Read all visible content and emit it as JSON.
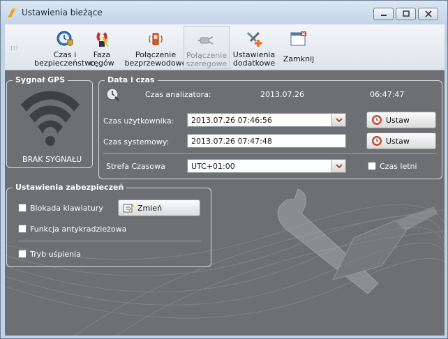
{
  "window": {
    "title": "Ustawienia bieżące"
  },
  "toolbar": {
    "buttons": [
      {
        "label": "Czas i\nbezpieczeństwo",
        "icon": "clock-shield-icon",
        "enabled": true
      },
      {
        "label": "Faza\ncęgów",
        "icon": "clamp-phase-icon",
        "enabled": true
      },
      {
        "label": "Połączenie\nbezprzewodowe",
        "icon": "wireless-phone-icon",
        "enabled": true
      },
      {
        "label": "Połączenie\nszeregowe",
        "icon": "serial-plug-icon",
        "enabled": false
      },
      {
        "label": "Ustawienia\ndodatkowe",
        "icon": "tools-plus-icon",
        "enabled": true
      },
      {
        "label": "Zamknij",
        "icon": "close-window-icon",
        "enabled": true
      }
    ]
  },
  "gps": {
    "title": "Sygnał GPS",
    "status": "BRAK SYGNAŁU"
  },
  "datetime": {
    "title": "Data i czas",
    "analyzer_label": "Czas analizatora:",
    "analyzer_date": "2013.07.26",
    "analyzer_time": "06:47:47",
    "user_label": "Czas użytkownika:",
    "user_value": "2013.07.26 07:46:56",
    "system_label": "Czas systemowy:",
    "system_value": "2013.07.26 07:47:48",
    "set_label": "Ustaw",
    "timezone_label": "Strefa Czasowa",
    "timezone_value": "UTC+01:00",
    "dst_label": "Czas letni"
  },
  "security": {
    "title": "Ustawienia zabezpieczeń",
    "keyboard_lock": "Blokada klawiatury",
    "change_label": "Zmień",
    "anti_theft": "Funkcja antykradzieżowa",
    "sleep_mode": "Tryb uśpienia"
  }
}
